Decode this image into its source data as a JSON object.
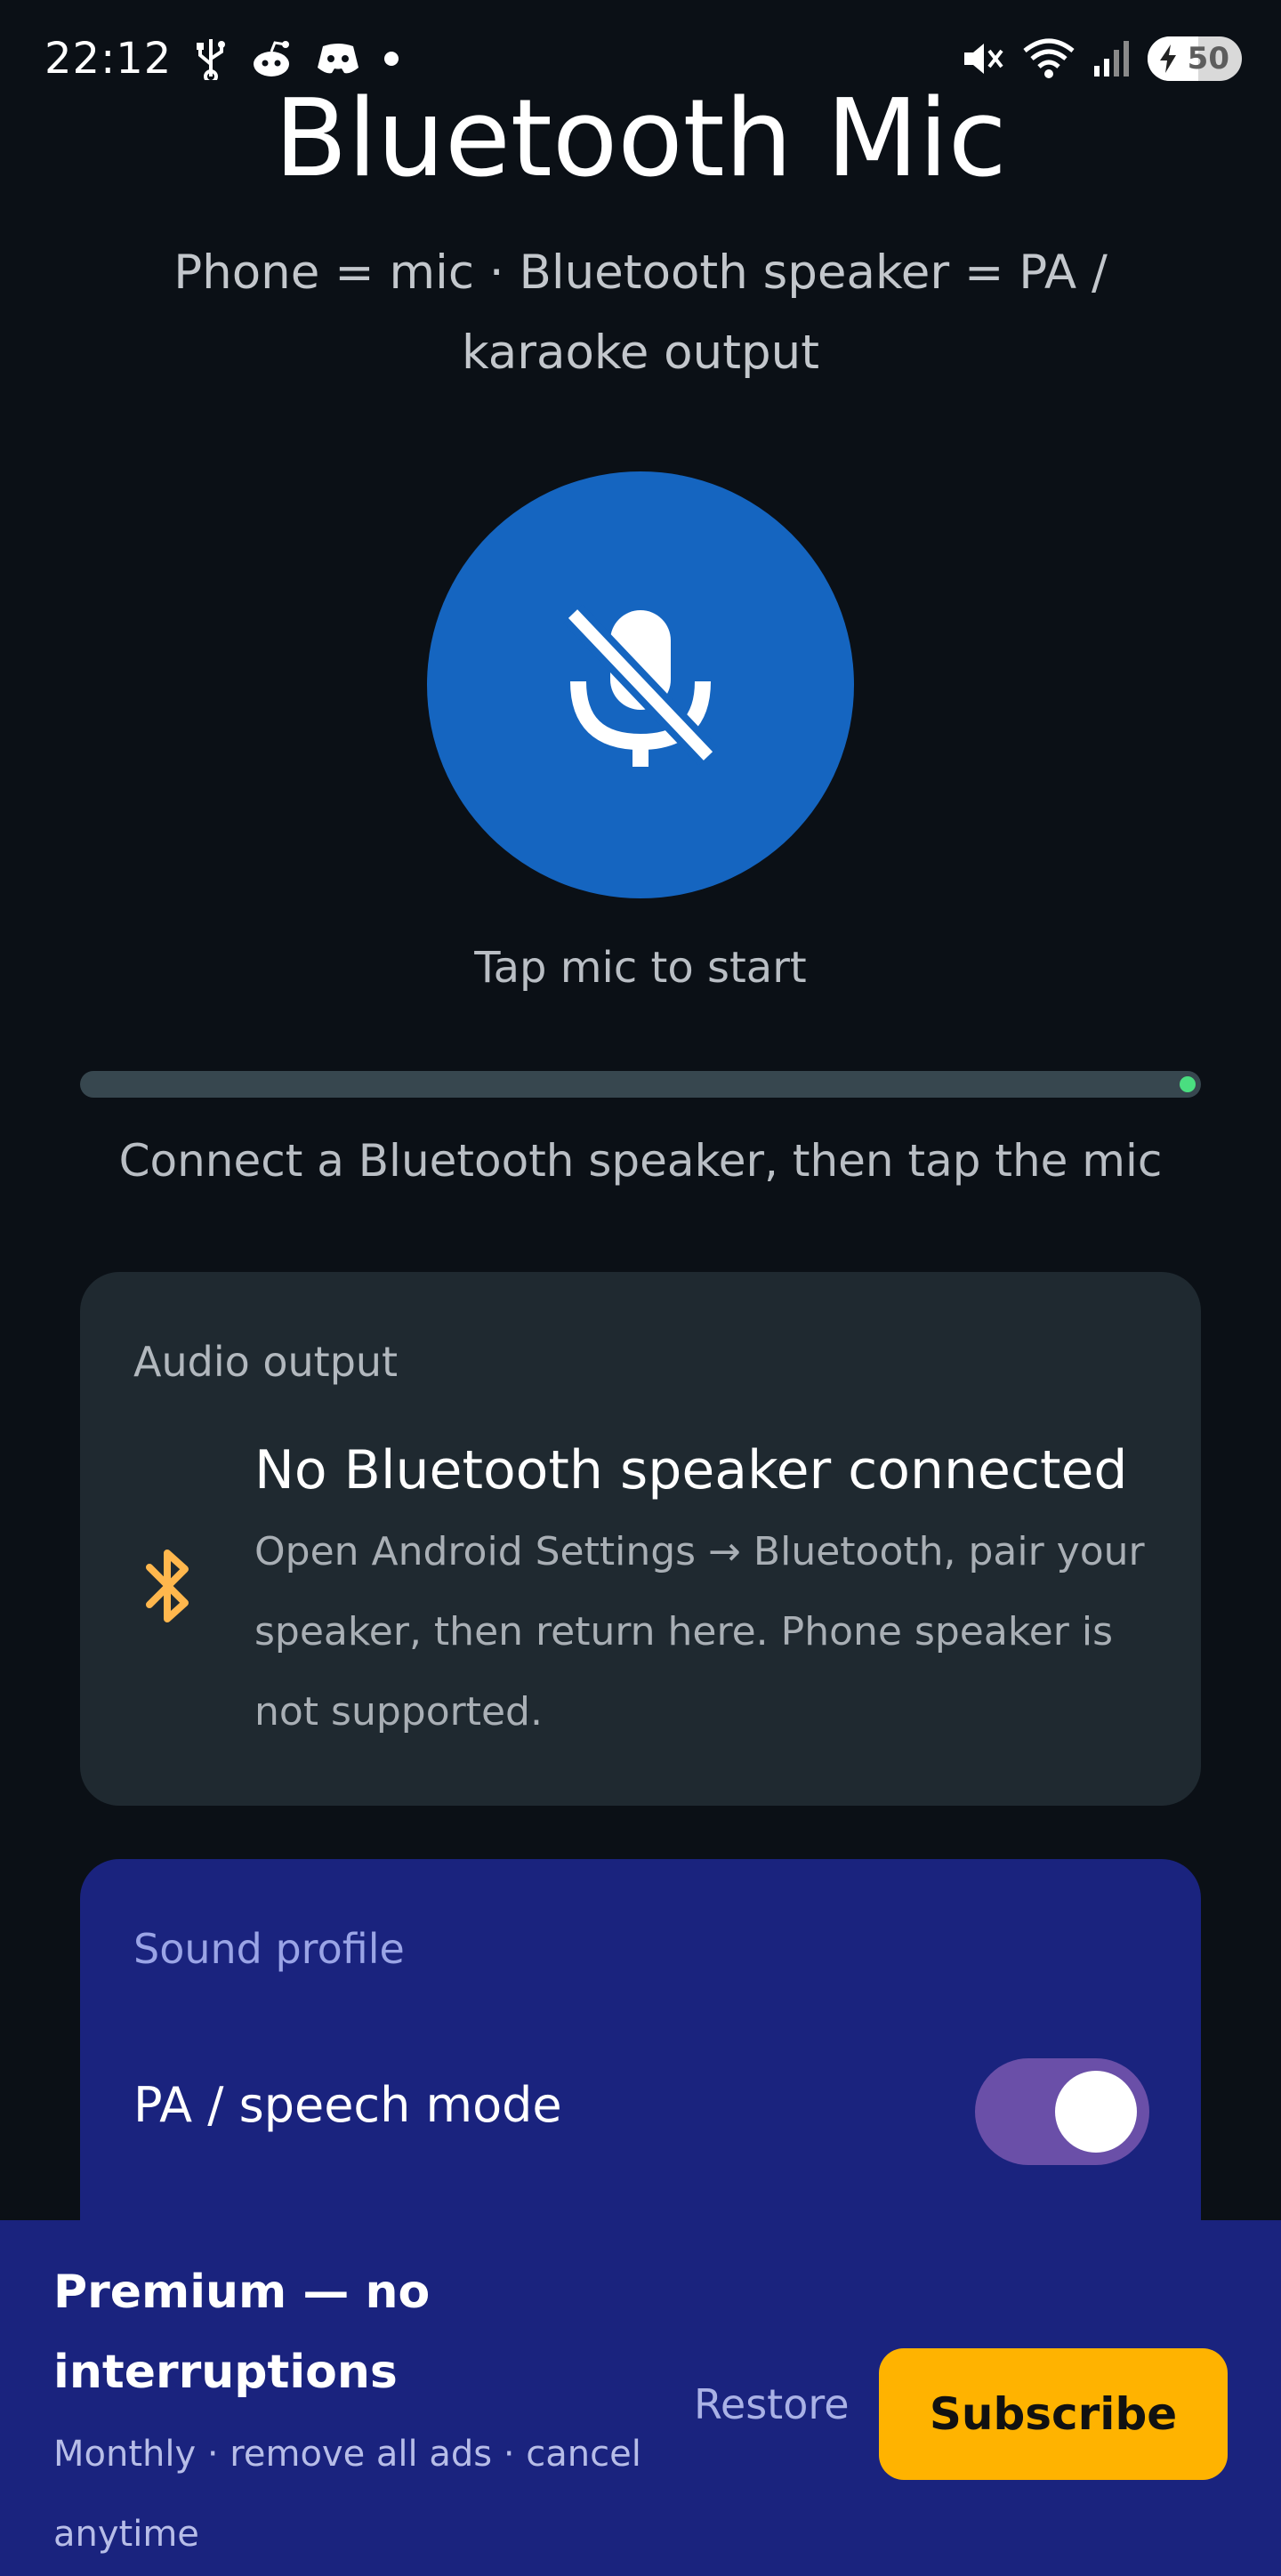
{
  "status_bar": {
    "time": "22:12",
    "battery": "50",
    "icons_left": [
      "usb-icon",
      "reddit-icon",
      "discord-icon",
      "dot-icon"
    ],
    "icons_right": [
      "mute-icon",
      "wifi-icon",
      "signal-icon",
      "battery-icon"
    ]
  },
  "header": {
    "title": "Bluetooth Mic",
    "subtitle": "Phone = mic · Bluetooth speaker = PA / karaoke output"
  },
  "mic": {
    "icon": "mic-off-icon",
    "hint": "Tap mic to start",
    "color": "#1565c0"
  },
  "status": {
    "text": "Connect a Bluetooth speaker, then tap the mic"
  },
  "audio_output": {
    "label": "Audio output",
    "icon": "bluetooth-icon",
    "title": "No Bluetooth speaker connected",
    "description": "Open Android Settings → Bluetooth, pair your speaker, then return here. Phone speaker is not supported."
  },
  "sound_profile": {
    "label": "Sound profile",
    "mode_label": "PA / speech mode",
    "mode_enabled": true
  },
  "premium": {
    "title": "Premium — no interruptions",
    "description": "Monthly · remove all ads · cancel anytime",
    "restore_label": "Restore",
    "subscribe_label": "Subscribe",
    "accent": "#ffb300"
  }
}
